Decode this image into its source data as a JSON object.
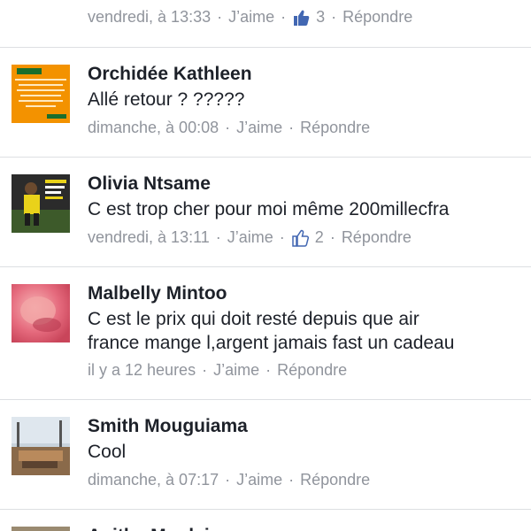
{
  "comments": [
    {
      "name": "",
      "text": "",
      "time": "vendredi, à 13:33",
      "like_label": "J’aime",
      "like_count": "3",
      "reply_label": "Répondre"
    },
    {
      "name": "Orchidée Kathleen",
      "text": "Allé retour ? ?????",
      "time": "dimanche, à 00:08",
      "like_label": "J’aime",
      "reply_label": "Répondre",
      "avatar_color": "#f39200"
    },
    {
      "name": "Olivia Ntsame",
      "text": "C est trop cher pour moi même 200millecfra",
      "time": "vendredi, à 13:11",
      "like_label": "J’aime",
      "like_count": "2",
      "reply_label": "Répondre"
    },
    {
      "name": "Malbelly Mintoo",
      "text_line1": "C est le prix qui doit resté depuis que air",
      "text_line2": "france mange l,argent jamais fast un cadeau",
      "time": "il y a 12 heures",
      "like_label": "J’aime",
      "reply_label": "Répondre"
    },
    {
      "name": "Smith Mouguiama",
      "text": "Cool",
      "time": "dimanche, à 07:17",
      "like_label": "J’aime",
      "reply_label": "Répondre"
    },
    {
      "name": "Anitha Mouleis"
    }
  ],
  "colors": {
    "link": "#90949c",
    "name": "#1d2129",
    "like_icon": "#4267b2",
    "divider": "#dddfe2"
  }
}
